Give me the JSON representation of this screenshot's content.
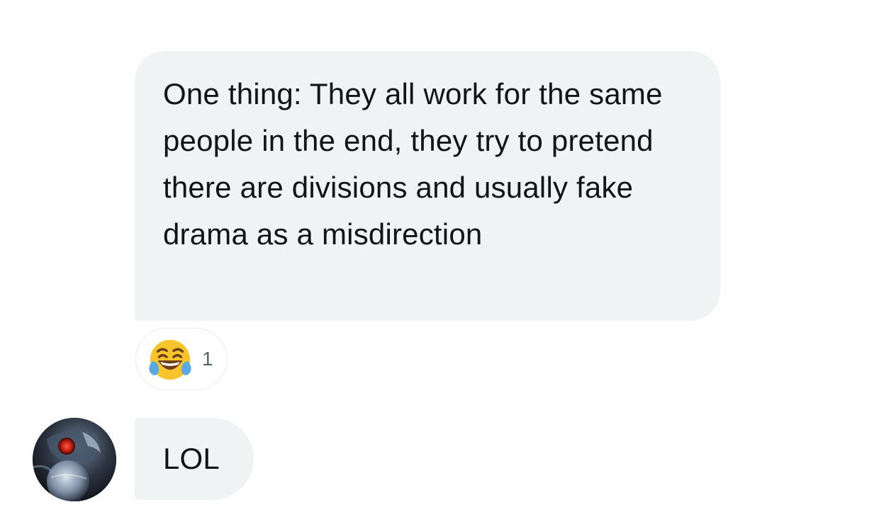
{
  "conversation": {
    "messages": [
      {
        "text": "One thing: They all work for the same people in the end, they try to pretend there are divisions and usually fake drama as a misdirection",
        "reaction": {
          "emoji": "face-with-tears-of-joy",
          "count": "1"
        }
      },
      {
        "text": "LOL",
        "avatar": "avatar-image"
      }
    ]
  },
  "colors": {
    "bubble_bg": "#eff3f4",
    "text": "#0f1419",
    "count_text": "#536471"
  }
}
